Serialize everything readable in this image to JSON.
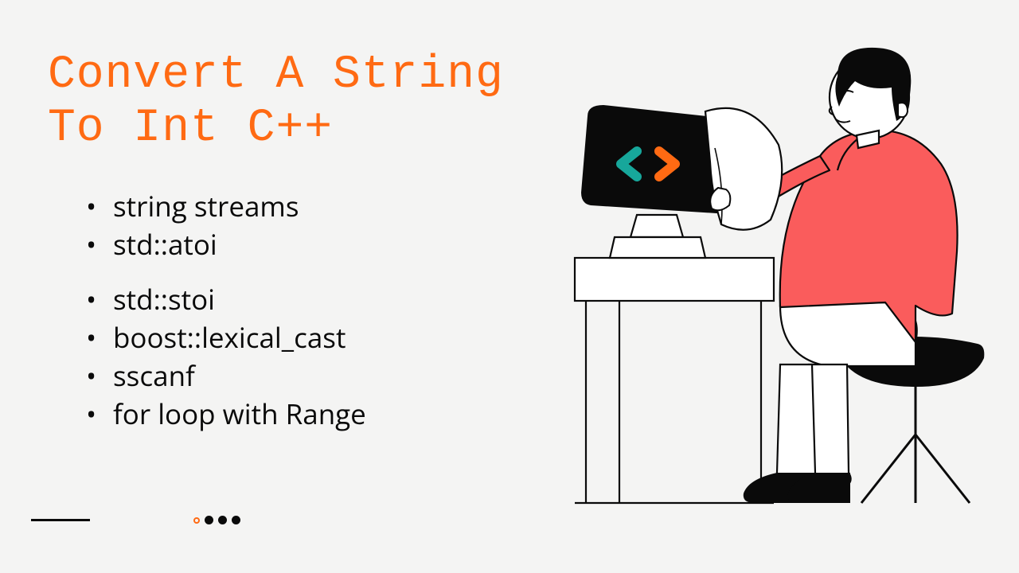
{
  "title_line1": "Convert A String",
  "title_line2": "To Int C++",
  "list": {
    "items": [
      "string streams",
      "std::atoi",
      "std::stoi",
      "boost::lexical_cast",
      "sscanf",
      "for loop with Range"
    ]
  },
  "colors": {
    "accent": "#ff6a13",
    "chevron_left": "#17a79b",
    "chevron_right": "#ff6a13",
    "person_shirt": "#fa5c5c",
    "stroke": "#0a0a0a",
    "background": "#f4f4f3"
  }
}
